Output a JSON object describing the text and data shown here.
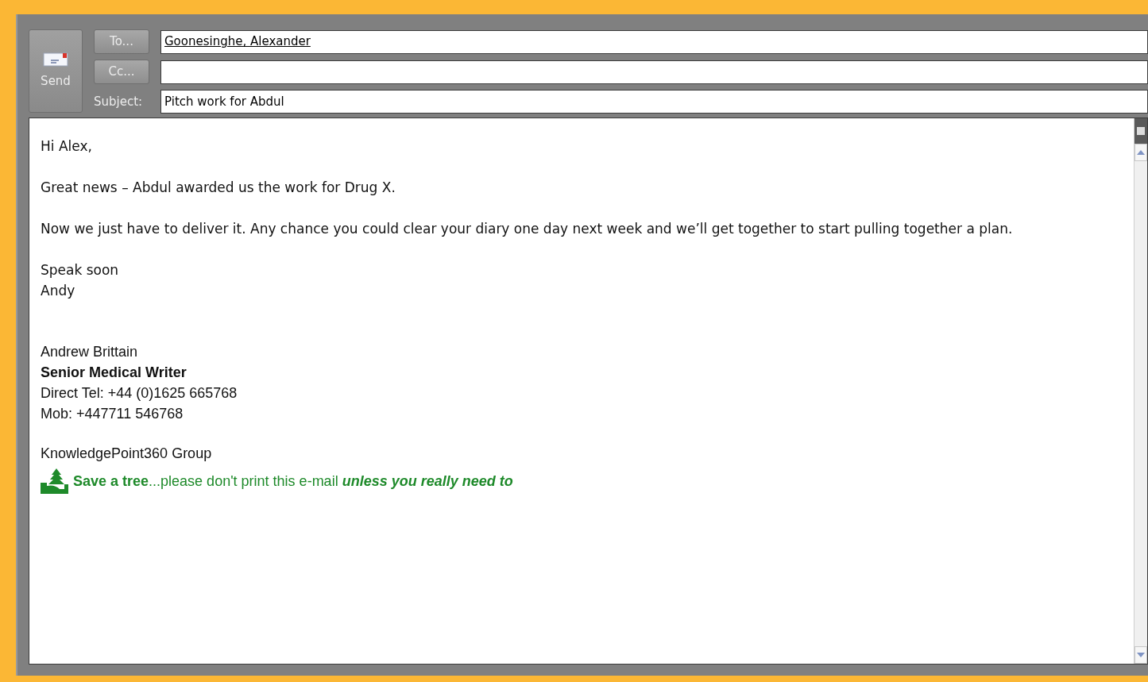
{
  "compose": {
    "send_button": "Send",
    "to_button": "To...",
    "to_value": "Goonesinghe, Alexander",
    "cc_button": "Cc...",
    "subject_label": "Subject:",
    "subject_value": "Pitch work for Abdul"
  },
  "body": {
    "paragraphs": [
      [
        "Hi Alex,"
      ],
      [
        "Great news – Abdul awarded us the work for Drug X."
      ],
      [
        "Now we just have to deliver it. Any chance you could clear your diary one day next week and we’ll get together to start pulling together a plan."
      ],
      [
        "Speak soon",
        "Andy"
      ]
    ]
  },
  "signature": {
    "name": "Andrew Brittain",
    "title": "Senior Medical Writer",
    "phone": "Direct Tel: +44 (0)1625 665768",
    "mobile": "Mob: +447711 546768",
    "company": "KnowledgePoint360 Group",
    "footer": "**Save a tree**...please don't print this e-mail *unless you really need to*"
  }
}
